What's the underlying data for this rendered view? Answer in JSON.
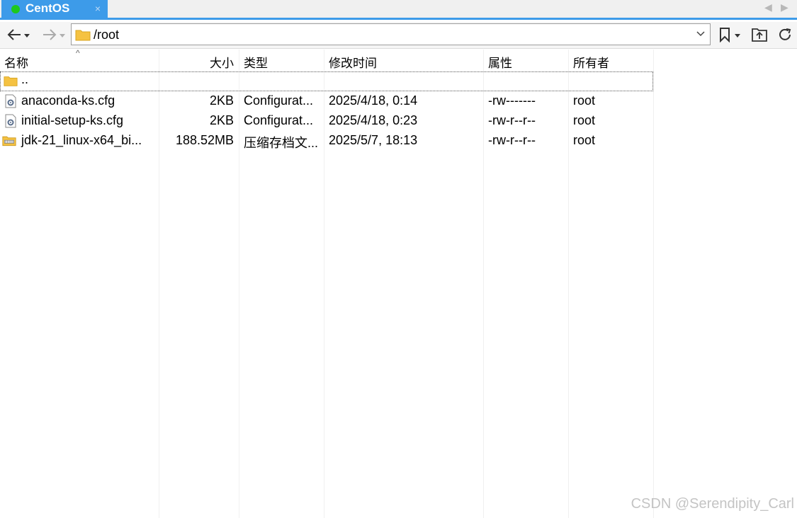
{
  "tab": {
    "title": "CentOS",
    "close": "×",
    "status_color": "#1ec81e"
  },
  "tab_nav": {
    "left": "◀",
    "right": "▶"
  },
  "address": {
    "path": "/root"
  },
  "columns": {
    "name": "名称",
    "size": "大小",
    "type": "类型",
    "modified": "修改时间",
    "attrs": "属性",
    "owner": "所有者",
    "sort_indicator": "^"
  },
  "parent": {
    "name": ".."
  },
  "files": [
    {
      "name": "anaconda-ks.cfg",
      "size": "2KB",
      "type": "Configurat...",
      "modified": "2025/4/18, 0:14",
      "attrs": "-rw-------",
      "owner": "root",
      "icon": "config-file-icon"
    },
    {
      "name": "initial-setup-ks.cfg",
      "size": "2KB",
      "type": "Configurat...",
      "modified": "2025/4/18, 0:23",
      "attrs": "-rw-r--r--",
      "owner": "root",
      "icon": "config-file-icon"
    },
    {
      "name": "jdk-21_linux-x64_bi...",
      "size": "188.52MB",
      "type": "压缩存档文...",
      "modified": "2025/5/7, 18:13",
      "attrs": "-rw-r--r--",
      "owner": "root",
      "icon": "archive-icon"
    }
  ],
  "watermark": "CSDN @Serendipity_Carl",
  "colors": {
    "accent": "#3d9be9",
    "folder": "#f5c242"
  }
}
